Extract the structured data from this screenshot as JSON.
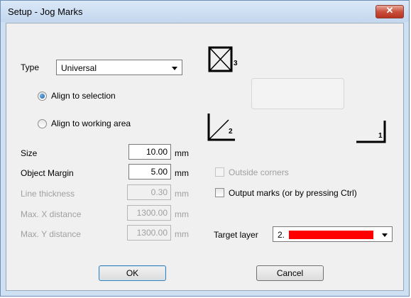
{
  "window": {
    "title": "Setup - Jog Marks",
    "close_glyph": "✕"
  },
  "type": {
    "label": "Type",
    "value": "Universal"
  },
  "align": [
    {
      "label": "Align to selection",
      "selected": true
    },
    {
      "label": "Align to working area",
      "selected": false
    }
  ],
  "fields": {
    "size": {
      "label": "Size",
      "value": "10.00",
      "unit": "mm"
    },
    "object_margin": {
      "label": "Object Margin",
      "value": "5.00",
      "unit": "mm"
    },
    "line_thickness": {
      "label": "Line thickness",
      "value": "0.30",
      "unit": "mm"
    },
    "max_x": {
      "label": "Max. X distance",
      "value": "1300.00",
      "unit": "mm"
    },
    "max_y": {
      "label": "Max. Y distance",
      "value": "1300.00",
      "unit": "mm"
    }
  },
  "marks": {
    "mark_3": "3",
    "mark_2": "2",
    "mark_1": "1"
  },
  "options": {
    "outside_corners": {
      "label": "Outside corners",
      "checked": false,
      "enabled": false
    },
    "output_marks": {
      "label": "Output marks (or by pressing Ctrl)",
      "checked": false,
      "enabled": true
    }
  },
  "target_layer": {
    "label": "Target layer",
    "value": "2.",
    "color": "#ff0000"
  },
  "buttons": {
    "ok": "OK",
    "cancel": "Cancel"
  }
}
